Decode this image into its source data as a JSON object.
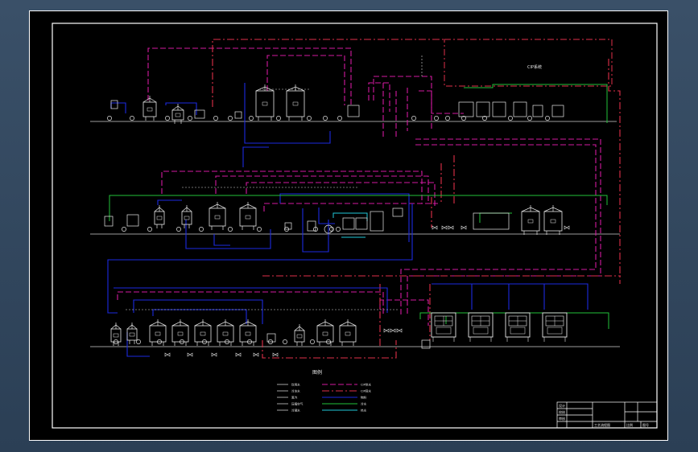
{
  "drawing": {
    "cip_label": "CIP系统",
    "legend_title": "图例",
    "legend_left": [
      "饮用水",
      "冷冻水",
      "蒸汽",
      "压缩空气",
      "冷凝水"
    ],
    "legend_right": [
      "CIP供水",
      "CIP回水",
      "物料",
      "冷水",
      "热水"
    ],
    "title_block": {
      "rows": [
        "设计",
        "校核",
        "审核"
      ],
      "name": "工艺流程图",
      "scale_label": "比例",
      "sheet_label": "图号"
    }
  },
  "colors": {
    "background": "#000000",
    "frame": "#ffffff",
    "cip_supply": "#d21aa0",
    "cip_return": "#e0304a",
    "material": "#1c2ae0",
    "cold_water": "#22c23a",
    "hot_water": "#20c8d8",
    "equipment": "#e8e8e8"
  }
}
